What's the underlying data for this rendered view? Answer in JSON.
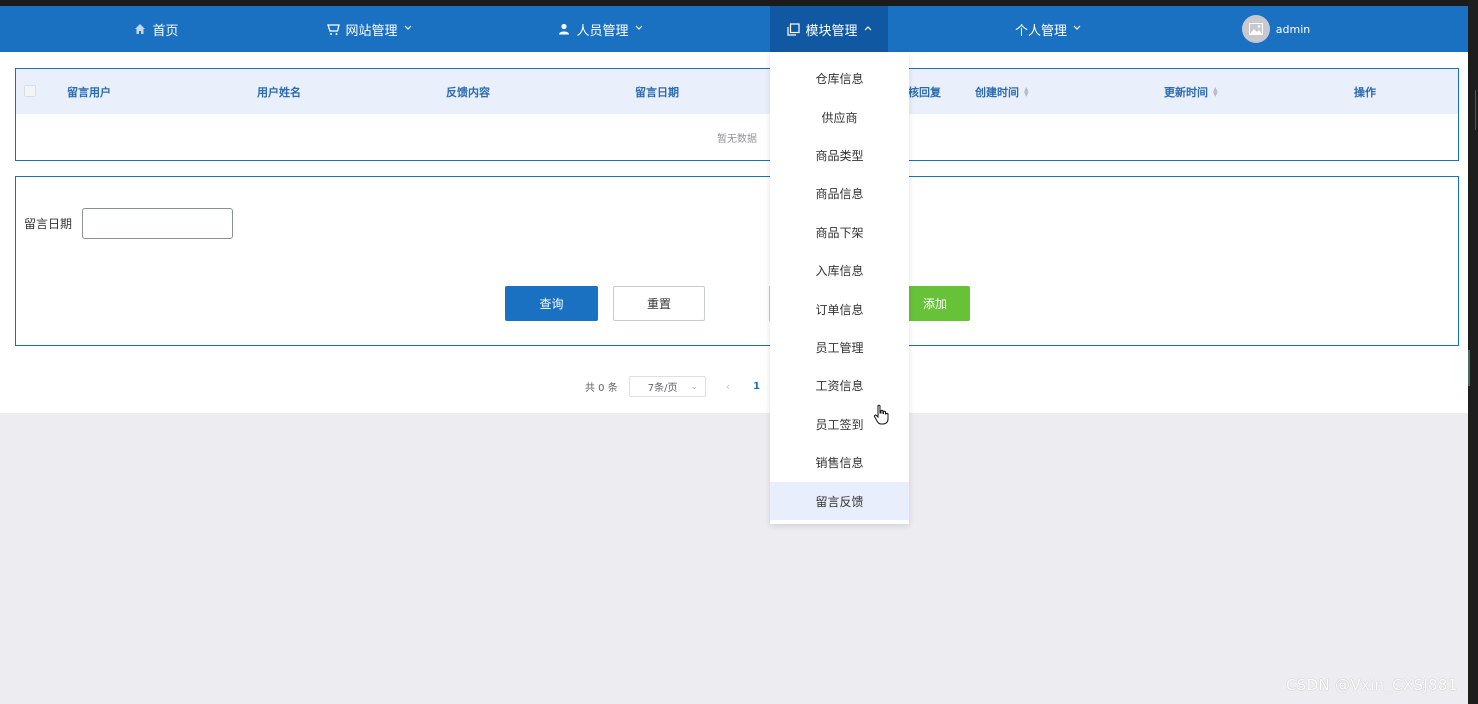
{
  "nav": {
    "home": "首页",
    "site_manage": "网站管理",
    "people_manage": "人员管理",
    "module_manage": "模块管理",
    "personal_manage": "个人管理",
    "user_name": "admin",
    "brand_color": "#1a70c1",
    "active_color": "#1158a2"
  },
  "table": {
    "headers": [
      "留言用户",
      "用户姓名",
      "反馈内容",
      "留言日期",
      "核回复",
      "创建时间",
      "更新时间",
      "操作"
    ],
    "empty_text": "暂无数据"
  },
  "search": {
    "date_label": "留言日期",
    "date_value": "",
    "query_label": "查询",
    "reset_label": "重置",
    "add_label": "添加"
  },
  "pagination": {
    "total": "共 0 条",
    "page_size": "7条/页",
    "prev": "‹",
    "current_page": "1"
  },
  "dropdown": {
    "items": [
      "仓库信息",
      "供应商",
      "商品类型",
      "商品信息",
      "商品下架",
      "入库信息",
      "订单信息",
      "员工管理",
      "工资信息",
      "员工签到",
      "销售信息",
      "留言反馈"
    ],
    "hovered": "留言反馈"
  },
  "watermark": "CSDN @Vxin_CXSJ881"
}
